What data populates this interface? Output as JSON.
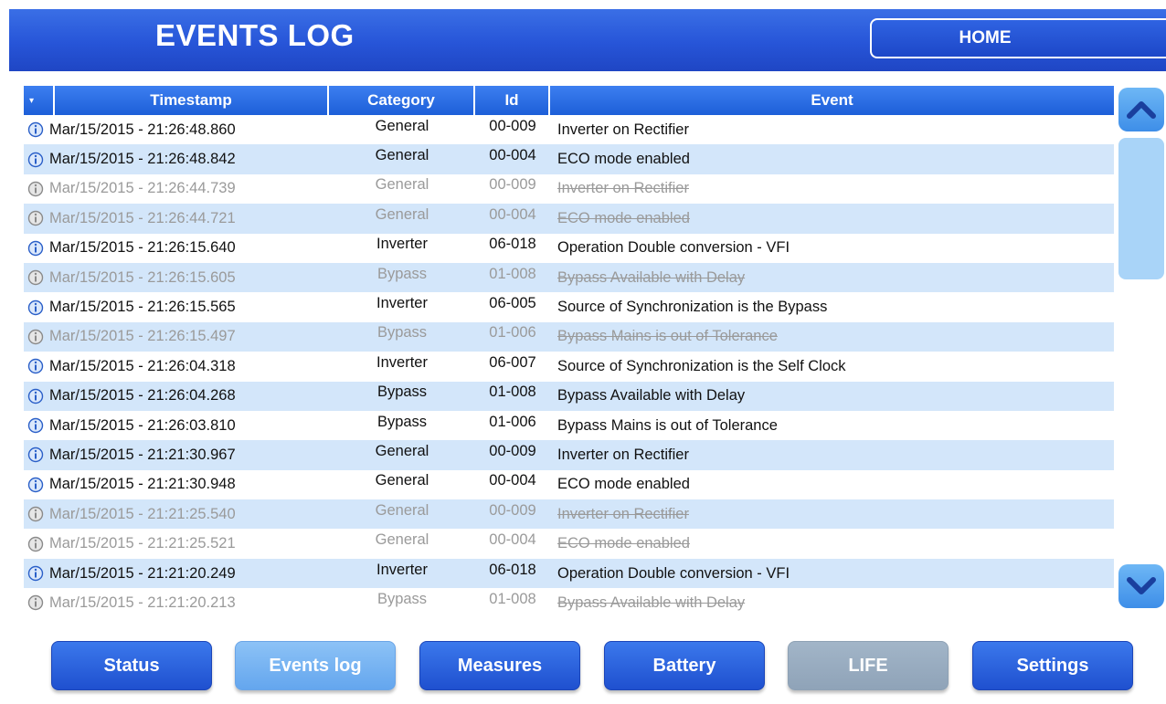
{
  "header": {
    "title": "EVENTS LOG",
    "home_label": "HOME"
  },
  "table": {
    "columns": [
      "Timestamp",
      "Category",
      "Id",
      "Event"
    ],
    "rows": [
      {
        "timestamp": "Mar/15/2015 - 21:26:48.860",
        "category": "General",
        "id": "00-009",
        "event": "Inverter on Rectifier",
        "state": "active"
      },
      {
        "timestamp": "Mar/15/2015 - 21:26:48.842",
        "category": "General",
        "id": "00-004",
        "event": "ECO mode enabled",
        "state": "active"
      },
      {
        "timestamp": "Mar/15/2015 - 21:26:44.739",
        "category": "General",
        "id": "00-009",
        "event": "Inverter on Rectifier",
        "state": "cleared"
      },
      {
        "timestamp": "Mar/15/2015 - 21:26:44.721",
        "category": "General",
        "id": "00-004",
        "event": "ECO mode enabled",
        "state": "cleared"
      },
      {
        "timestamp": "Mar/15/2015 - 21:26:15.640",
        "category": "Inverter",
        "id": "06-018",
        "event": "Operation  Double conversion - VFI",
        "state": "active"
      },
      {
        "timestamp": "Mar/15/2015 - 21:26:15.605",
        "category": "Bypass",
        "id": "01-008",
        "event": "Bypass Available with Delay",
        "state": "cleared"
      },
      {
        "timestamp": "Mar/15/2015 - 21:26:15.565",
        "category": "Inverter",
        "id": "06-005",
        "event": "Source of Synchronization is the Bypass",
        "state": "active"
      },
      {
        "timestamp": "Mar/15/2015 - 21:26:15.497",
        "category": "Bypass",
        "id": "01-006",
        "event": "Bypass Mains is out of Tolerance",
        "state": "cleared"
      },
      {
        "timestamp": "Mar/15/2015 - 21:26:04.318",
        "category": "Inverter",
        "id": "06-007",
        "event": "Source of Synchronization is the Self Clock",
        "state": "active"
      },
      {
        "timestamp": "Mar/15/2015 - 21:26:04.268",
        "category": "Bypass",
        "id": "01-008",
        "event": "Bypass Available with Delay",
        "state": "active"
      },
      {
        "timestamp": "Mar/15/2015 - 21:26:03.810",
        "category": "Bypass",
        "id": "01-006",
        "event": "Bypass Mains is out of Tolerance",
        "state": "active"
      },
      {
        "timestamp": "Mar/15/2015 - 21:21:30.967",
        "category": "General",
        "id": "00-009",
        "event": "Inverter on Rectifier",
        "state": "active"
      },
      {
        "timestamp": "Mar/15/2015 - 21:21:30.948",
        "category": "General",
        "id": "00-004",
        "event": "ECO mode enabled",
        "state": "active"
      },
      {
        "timestamp": "Mar/15/2015 - 21:21:25.540",
        "category": "General",
        "id": "00-009",
        "event": "Inverter on Rectifier",
        "state": "cleared"
      },
      {
        "timestamp": "Mar/15/2015 - 21:21:25.521",
        "category": "General",
        "id": "00-004",
        "event": "ECO mode enabled",
        "state": "cleared"
      },
      {
        "timestamp": "Mar/15/2015 - 21:21:20.249",
        "category": "Inverter",
        "id": "06-018",
        "event": "Operation  Double conversion - VFI",
        "state": "active"
      },
      {
        "timestamp": "Mar/15/2015 - 21:21:20.213",
        "category": "Bypass",
        "id": "01-008",
        "event": "Bypass Available with Delay",
        "state": "cleared"
      }
    ],
    "row_icon": "info-icon"
  },
  "scroll": {
    "up_icon": "chevron-up-icon",
    "down_icon": "chevron-down-icon"
  },
  "nav": {
    "items": [
      {
        "label": "Status",
        "state": "normal"
      },
      {
        "label": "Events log",
        "state": "active"
      },
      {
        "label": "Measures",
        "state": "normal"
      },
      {
        "label": "Battery",
        "state": "normal"
      },
      {
        "label": "LIFE",
        "state": "disabled"
      },
      {
        "label": "Settings",
        "state": "normal"
      }
    ]
  },
  "colors": {
    "header_blue": "#2755d8",
    "row_alt": "#d3e6fa",
    "dim_text": "#9a9a9a",
    "nav_active": "#7ab4f2",
    "nav_disabled": "#98abbf"
  }
}
